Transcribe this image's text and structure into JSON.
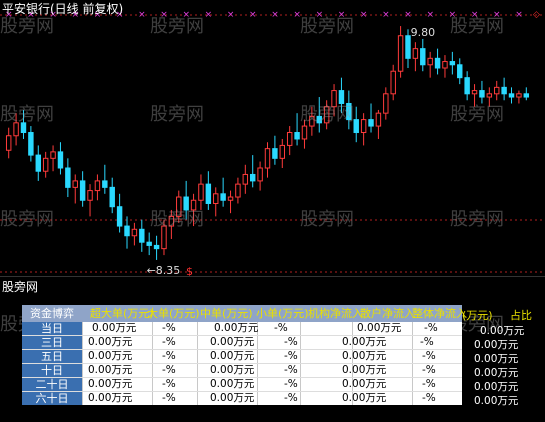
{
  "window": {
    "title": "平安银行(日线 前复权)",
    "sub_title": "股旁网"
  },
  "watermark": "股旁网",
  "chart_data": {
    "type": "candlestick",
    "title": "平安银行(日线 前复权)",
    "high_label": "9.80",
    "low_label": "←8.35",
    "up_color": "#ff3b3b",
    "down_color": "#2ad9ff",
    "candles": [
      [
        9.03,
        9.17,
        8.98,
        9.12
      ],
      [
        9.12,
        9.26,
        9.06,
        9.2
      ],
      [
        9.2,
        9.28,
        9.1,
        9.14
      ],
      [
        9.14,
        9.18,
        8.96,
        9.0
      ],
      [
        9.0,
        9.06,
        8.84,
        8.9
      ],
      [
        8.9,
        9.02,
        8.86,
        8.98
      ],
      [
        8.98,
        9.06,
        8.9,
        9.02
      ],
      [
        9.02,
        9.08,
        8.88,
        8.92
      ],
      [
        8.92,
        8.98,
        8.74,
        8.8
      ],
      [
        8.8,
        8.88,
        8.7,
        8.84
      ],
      [
        8.84,
        8.9,
        8.68,
        8.72
      ],
      [
        8.72,
        8.82,
        8.62,
        8.78
      ],
      [
        8.78,
        8.88,
        8.72,
        8.84
      ],
      [
        8.84,
        8.94,
        8.76,
        8.8
      ],
      [
        8.8,
        8.86,
        8.64,
        8.68
      ],
      [
        8.68,
        8.76,
        8.52,
        8.56
      ],
      [
        8.56,
        8.62,
        8.42,
        8.5
      ],
      [
        8.5,
        8.58,
        8.44,
        8.54
      ],
      [
        8.54,
        8.6,
        8.4,
        8.46
      ],
      [
        8.46,
        8.52,
        8.38,
        8.44
      ],
      [
        8.44,
        8.5,
        8.35,
        8.42
      ],
      [
        8.42,
        8.6,
        8.38,
        8.56
      ],
      [
        8.56,
        8.66,
        8.48,
        8.62
      ],
      [
        8.62,
        8.78,
        8.58,
        8.74
      ],
      [
        8.74,
        8.84,
        8.6,
        8.66
      ],
      [
        8.66,
        8.76,
        8.56,
        8.72
      ],
      [
        8.72,
        8.88,
        8.66,
        8.82
      ],
      [
        8.82,
        8.9,
        8.66,
        8.7
      ],
      [
        8.7,
        8.8,
        8.62,
        8.76
      ],
      [
        8.76,
        8.86,
        8.68,
        8.72
      ],
      [
        8.72,
        8.78,
        8.64,
        8.74
      ],
      [
        8.74,
        8.86,
        8.7,
        8.82
      ],
      [
        8.82,
        8.94,
        8.76,
        8.88
      ],
      [
        8.88,
        9.0,
        8.8,
        8.84
      ],
      [
        8.84,
        8.96,
        8.78,
        8.92
      ],
      [
        8.92,
        9.08,
        8.86,
        9.04
      ],
      [
        9.04,
        9.12,
        8.94,
        8.98
      ],
      [
        8.98,
        9.1,
        8.92,
        9.06
      ],
      [
        9.06,
        9.18,
        9.0,
        9.14
      ],
      [
        9.14,
        9.26,
        9.06,
        9.1
      ],
      [
        9.1,
        9.22,
        9.04,
        9.18
      ],
      [
        9.18,
        9.3,
        9.12,
        9.24
      ],
      [
        9.24,
        9.36,
        9.14,
        9.2
      ],
      [
        9.2,
        9.34,
        9.16,
        9.3
      ],
      [
        9.3,
        9.44,
        9.24,
        9.4
      ],
      [
        9.4,
        9.48,
        9.26,
        9.32
      ],
      [
        9.32,
        9.4,
        9.16,
        9.22
      ],
      [
        9.22,
        9.3,
        9.08,
        9.14
      ],
      [
        9.14,
        9.26,
        9.06,
        9.22
      ],
      [
        9.22,
        9.32,
        9.14,
        9.18
      ],
      [
        9.18,
        9.28,
        9.1,
        9.26
      ],
      [
        9.26,
        9.42,
        9.22,
        9.38
      ],
      [
        9.38,
        9.56,
        9.34,
        9.52
      ],
      [
        9.52,
        9.8,
        9.48,
        9.74
      ],
      [
        9.74,
        9.78,
        9.54,
        9.6
      ],
      [
        9.6,
        9.7,
        9.52,
        9.66
      ],
      [
        9.66,
        9.72,
        9.52,
        9.56
      ],
      [
        9.56,
        9.64,
        9.48,
        9.6
      ],
      [
        9.6,
        9.66,
        9.5,
        9.54
      ],
      [
        9.54,
        9.62,
        9.48,
        9.58
      ],
      [
        9.58,
        9.64,
        9.5,
        9.56
      ],
      [
        9.56,
        9.6,
        9.44,
        9.48
      ],
      [
        9.48,
        9.52,
        9.34,
        9.38
      ],
      [
        9.38,
        9.44,
        9.3,
        9.4
      ],
      [
        9.4,
        9.46,
        9.32,
        9.36
      ],
      [
        9.36,
        9.42,
        9.3,
        9.38
      ],
      [
        9.38,
        9.46,
        9.34,
        9.42
      ],
      [
        9.42,
        9.48,
        9.34,
        9.38
      ],
      [
        9.38,
        9.42,
        9.32,
        9.36
      ],
      [
        9.36,
        9.4,
        9.32,
        9.38
      ],
      [
        9.38,
        9.42,
        9.34,
        9.36
      ]
    ]
  },
  "table": {
    "headers": [
      "资金博弈",
      "超大单(万元)",
      "大单(万元)",
      "中单(万元)",
      "小单(万元)",
      "机构净流入",
      "散户净流入",
      "整体净流入",
      "(万元)",
      "占比"
    ],
    "rows": [
      {
        "label": "当日",
        "cells": [
          "0.00万元",
          "-%",
          "0.00万元",
          "-%",
          "0.00万元",
          "-%",
          "0.00万元"
        ]
      },
      {
        "label": "三日",
        "cells": [
          "0.00万元",
          "-%",
          "0.00万元",
          "-%",
          "0.00万元",
          "-%",
          "0.00万元"
        ]
      },
      {
        "label": "五日",
        "cells": [
          "0.00万元",
          "-%",
          "0.00万元",
          "-%",
          "0.00万元",
          "-%",
          "0.00万元"
        ]
      },
      {
        "label": "十日",
        "cells": [
          "0.00万元",
          "-%",
          "0.00万元",
          "-%",
          "0.00万元",
          "-%",
          "0.00万元"
        ]
      },
      {
        "label": "二十日",
        "cells": [
          "0.00万元",
          "-%",
          "0.00万元",
          "-%",
          "0.00万元",
          "-%",
          "0.00万元"
        ]
      },
      {
        "label": "六十日",
        "cells": [
          "0.00万元",
          "-%",
          "0.00万元",
          "-%",
          "0.00万元",
          "-%",
          "0.00万元"
        ]
      }
    ]
  },
  "colors": {
    "background": "#000000",
    "table_header": "#8fa4c8",
    "row_label": "#3a6fb0",
    "header_text": "#e9e000",
    "marker": "#e040e0"
  }
}
